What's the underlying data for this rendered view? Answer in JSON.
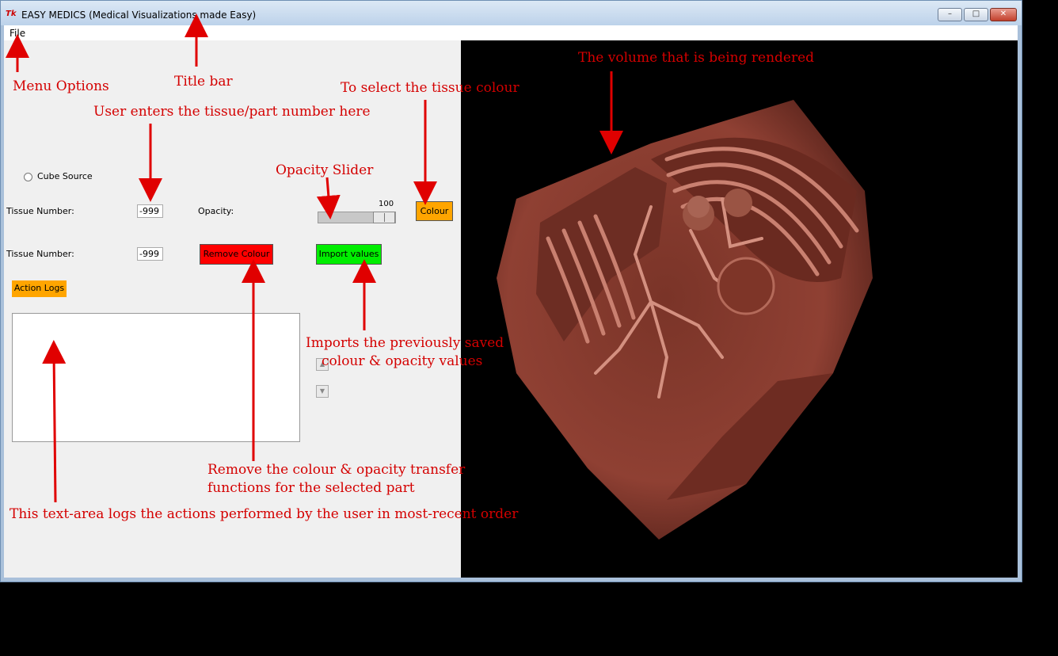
{
  "window": {
    "title": "EASY MEDICS (Medical Visualizations made Easy)",
    "icon": "Tk",
    "controls": {
      "minimize": "–",
      "maximize": "□",
      "close": "✕"
    }
  },
  "menubar": {
    "file": "File"
  },
  "panel": {
    "cube_source": "Cube Source",
    "tissue_label_1": "Tissue Number:",
    "tissue_value_1": "-999",
    "opacity_label": "Opacity:",
    "opacity_value": "100",
    "opacity_level": 1.0,
    "colour_button": "Colour",
    "tissue_label_2": "Tissue Number:",
    "tissue_value_2": "-999",
    "remove_colour_button": "Remove Colour",
    "import_values_button": "Import values",
    "action_logs_button": "Action Logs",
    "scroll_up": "▲",
    "scroll_down": "▼"
  },
  "annotations": {
    "menu_options": "Menu Options",
    "title_bar": "Title bar",
    "tissue_colour": "To select the tissue colour",
    "user_enters": "User enters the tissue/part number here",
    "volume": "The volume that is being rendered",
    "opacity_slider": "Opacity Slider",
    "imports_1": "Imports the previously saved",
    "imports_2": "colour & opacity values",
    "remove_1": "Remove the colour & opacity transfer",
    "remove_2": "functions for the selected part",
    "logs": "This text-area logs the actions performed by the user in most-recent order"
  },
  "colors": {
    "colour_button": "#ffa500",
    "remove_button": "#ff0000",
    "import_button": "#00ee00",
    "action_logs_button": "#ffa500",
    "annotation": "#d40000",
    "volume": "#8a3a2e"
  }
}
